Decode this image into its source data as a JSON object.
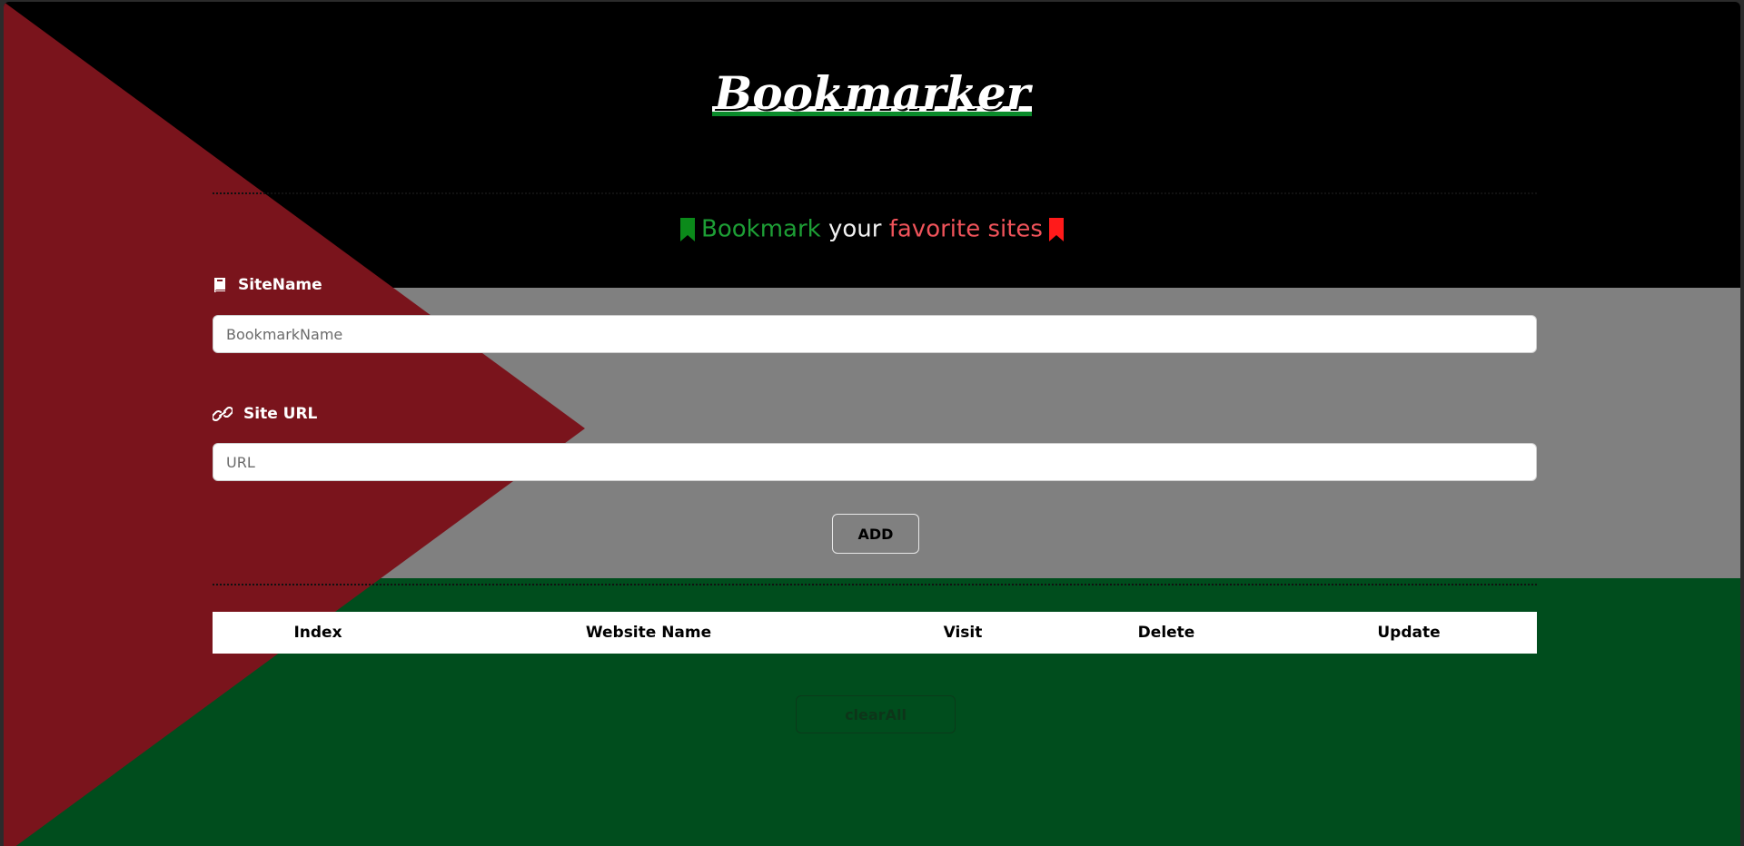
{
  "header": {
    "logo_text": "Bookmarker"
  },
  "tagline": {
    "part1": "Bookmark",
    "part2": "your",
    "part3": "favorite",
    "part4": "sites",
    "color_green": "#1d9e35",
    "color_white": "#f2f2f2",
    "color_red": "#f0535a",
    "left_icon_color": "#0b8a1a",
    "right_icon_color": "#ff1a1a",
    "left_icon": "bookmark-icon",
    "right_icon": "bookmark-icon"
  },
  "form": {
    "site_name_label": "SiteName",
    "site_name_icon": "book-icon",
    "site_name_placeholder": "BookmarkName",
    "site_url_label": "Site URL",
    "site_url_icon": "link-icon",
    "site_url_placeholder": "URL",
    "add_label": "ADD"
  },
  "table": {
    "columns": [
      "Index",
      "Website Name",
      "Visit",
      "Delete",
      "Update"
    ],
    "rows": []
  },
  "actions": {
    "clear_all_label": "clearAll"
  },
  "colors": {
    "band_black": "#000000",
    "band_gray": "#808080",
    "band_green": "#004d1d",
    "triangle_red": "#7a141c"
  }
}
